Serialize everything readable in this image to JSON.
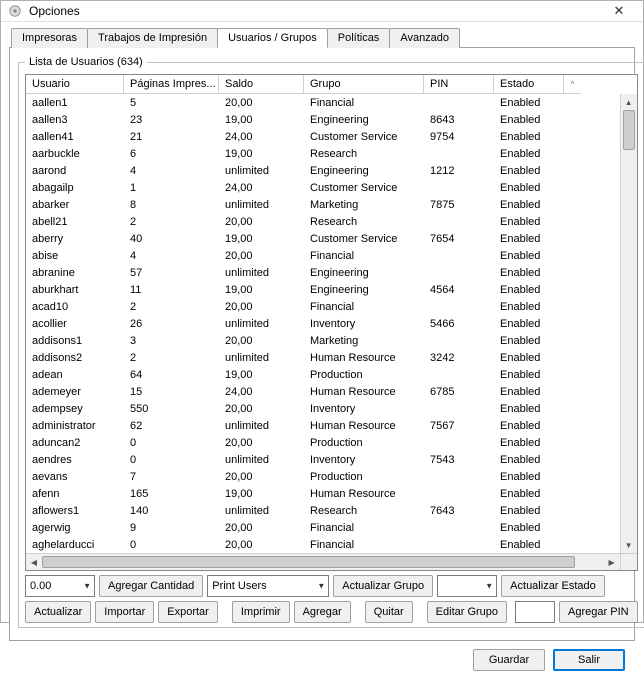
{
  "window": {
    "title": "Opciones"
  },
  "tabs": [
    "Impresoras",
    "Trabajos de Impresión",
    "Usuarios / Grupos",
    "Políticas",
    "Avanzado"
  ],
  "active_tab": 2,
  "userlist": {
    "legend": "Lista de Usuarios (634)",
    "columns": [
      "Usuario",
      "Páginas Impres...",
      "Saldo",
      "Grupo",
      "PIN",
      "Estado"
    ],
    "rows": [
      {
        "user": "aallen1",
        "pages": "5",
        "saldo": "20,00",
        "grupo": "Financial",
        "pin": "",
        "estado": "Enabled"
      },
      {
        "user": "aallen3",
        "pages": "23",
        "saldo": "19,00",
        "grupo": "Engineering",
        "pin": "8643",
        "estado": "Enabled"
      },
      {
        "user": "aallen41",
        "pages": "21",
        "saldo": "24,00",
        "grupo": "Customer Service",
        "pin": "9754",
        "estado": "Enabled"
      },
      {
        "user": "aarbuckle",
        "pages": "6",
        "saldo": "19,00",
        "grupo": "Research",
        "pin": "",
        "estado": "Enabled"
      },
      {
        "user": "aarond",
        "pages": "4",
        "saldo": "unlimited",
        "grupo": "Engineering",
        "pin": "1212",
        "estado": "Enabled"
      },
      {
        "user": "abagailp",
        "pages": "1",
        "saldo": "24,00",
        "grupo": "Customer Service",
        "pin": "",
        "estado": "Enabled"
      },
      {
        "user": "abarker",
        "pages": "8",
        "saldo": "unlimited",
        "grupo": "Marketing",
        "pin": "7875",
        "estado": "Enabled"
      },
      {
        "user": "abell21",
        "pages": "2",
        "saldo": "20,00",
        "grupo": "Research",
        "pin": "",
        "estado": "Enabled"
      },
      {
        "user": "aberry",
        "pages": "40",
        "saldo": "19,00",
        "grupo": "Customer Service",
        "pin": "7654",
        "estado": "Enabled"
      },
      {
        "user": "abise",
        "pages": "4",
        "saldo": "20,00",
        "grupo": "Financial",
        "pin": "",
        "estado": "Enabled"
      },
      {
        "user": "abranine",
        "pages": "57",
        "saldo": "unlimited",
        "grupo": "Engineering",
        "pin": "",
        "estado": "Enabled"
      },
      {
        "user": "aburkhart",
        "pages": "11",
        "saldo": "19,00",
        "grupo": "Engineering",
        "pin": "4564",
        "estado": "Enabled"
      },
      {
        "user": "acad10",
        "pages": "2",
        "saldo": "20,00",
        "grupo": "Financial",
        "pin": "",
        "estado": "Enabled"
      },
      {
        "user": "acollier",
        "pages": "26",
        "saldo": "unlimited",
        "grupo": "Inventory",
        "pin": "5466",
        "estado": "Enabled"
      },
      {
        "user": "addisons1",
        "pages": "3",
        "saldo": "20,00",
        "grupo": "Marketing",
        "pin": "",
        "estado": "Enabled"
      },
      {
        "user": "addisons2",
        "pages": "2",
        "saldo": "unlimited",
        "grupo": "Human Resource",
        "pin": "3242",
        "estado": "Enabled"
      },
      {
        "user": "adean",
        "pages": "64",
        "saldo": "19,00",
        "grupo": "Production",
        "pin": "",
        "estado": "Enabled"
      },
      {
        "user": "ademeyer",
        "pages": "15",
        "saldo": "24,00",
        "grupo": "Human Resource",
        "pin": "6785",
        "estado": "Enabled"
      },
      {
        "user": "adempsey",
        "pages": "550",
        "saldo": "20,00",
        "grupo": "Inventory",
        "pin": "",
        "estado": "Enabled"
      },
      {
        "user": "administrator",
        "pages": "62",
        "saldo": "unlimited",
        "grupo": "Human Resource",
        "pin": "7567",
        "estado": "Enabled"
      },
      {
        "user": "aduncan2",
        "pages": "0",
        "saldo": "20,00",
        "grupo": "Production",
        "pin": "",
        "estado": "Enabled"
      },
      {
        "user": "aendres",
        "pages": "0",
        "saldo": "unlimited",
        "grupo": "Inventory",
        "pin": "7543",
        "estado": "Enabled"
      },
      {
        "user": "aevans",
        "pages": "7",
        "saldo": "20,00",
        "grupo": "Production",
        "pin": "",
        "estado": "Enabled"
      },
      {
        "user": "afenn",
        "pages": "165",
        "saldo": "19,00",
        "grupo": "Human Resource",
        "pin": "",
        "estado": "Enabled"
      },
      {
        "user": "aflowers1",
        "pages": "140",
        "saldo": "unlimited",
        "grupo": "Research",
        "pin": "7643",
        "estado": "Enabled"
      },
      {
        "user": "agerwig",
        "pages": "9",
        "saldo": "20,00",
        "grupo": "Financial",
        "pin": "",
        "estado": "Enabled"
      },
      {
        "user": "aghelarducci",
        "pages": "0",
        "saldo": "20,00",
        "grupo": "Financial",
        "pin": "",
        "estado": "Enabled"
      }
    ]
  },
  "controls": {
    "amount_value": "0.00",
    "add_amount": "Agregar Cantidad",
    "group_select": "Print Users",
    "update_group": "Actualizar Grupo",
    "state_select": "",
    "update_state": "Actualizar Estado",
    "refresh": "Actualizar",
    "import": "Importar",
    "export": "Exportar",
    "print": "Imprimir",
    "add": "Agregar",
    "remove": "Quitar",
    "edit_group": "Editar Grupo",
    "pin_value": "",
    "add_pin": "Agregar PIN"
  },
  "bottom": {
    "save": "Guardar",
    "exit": "Salir"
  }
}
